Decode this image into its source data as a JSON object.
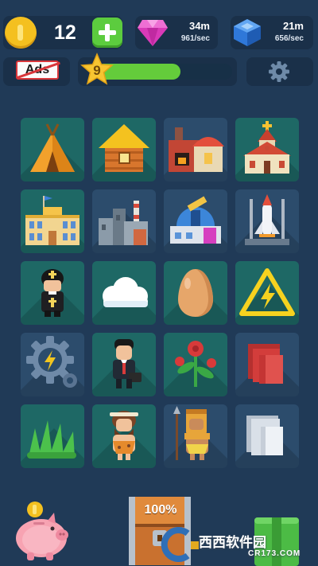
{
  "header": {
    "coins": "12",
    "pink_gem": {
      "total": "34m",
      "rate": "961/sec"
    },
    "blue_gem": {
      "total": "21m",
      "rate": "656/sec"
    }
  },
  "toolbar": {
    "ads_label": "Ads",
    "level": "9",
    "level_progress": 0.62
  },
  "grid": {
    "rows": [
      [
        "teepee",
        "log-cabin",
        "workshop",
        "church"
      ],
      [
        "school",
        "factory",
        "observatory",
        "space-shuttle"
      ],
      [
        "priest",
        "cloud",
        "egg",
        "electricity-sign"
      ],
      [
        "energy-gear",
        "businessman",
        "red-flower",
        "red-meat"
      ],
      [
        "grass",
        "caveman",
        "tribal-warrior",
        "stone-block"
      ]
    ]
  },
  "chest": {
    "percent": "100%"
  },
  "watermark": {
    "text": "西西软件园",
    "url": "CR173.COM"
  },
  "colors": {
    "background": "#203a57",
    "tile_green": "#1e6865",
    "tile_blue": "#2c4c6c",
    "progress_green": "#64cc3b",
    "coin_gold": "#f4c01f",
    "plus_green": "#5ccc3e",
    "pink_gem": "#d93ab8",
    "blue_gem": "#2f78d9"
  }
}
